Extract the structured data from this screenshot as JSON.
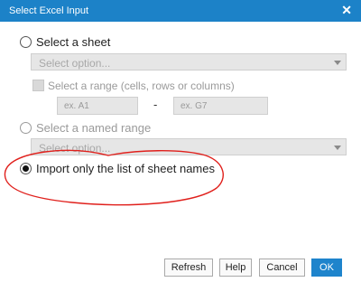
{
  "window": {
    "title": "Select Excel Input",
    "close_symbol": "✕"
  },
  "options": {
    "sheet": {
      "label": "Select a sheet",
      "select_placeholder": "Select option..."
    },
    "range": {
      "label": "Select a range (cells, rows or columns)",
      "from_placeholder": "ex. A1",
      "separator": "-",
      "to_placeholder": "ex. G7"
    },
    "named_range": {
      "label": "Select a named range",
      "select_placeholder": "Select option..."
    },
    "import_names": {
      "label": "Import only the list of sheet names",
      "selected": true
    }
  },
  "buttons": {
    "refresh": "Refresh",
    "help": "Help",
    "cancel": "Cancel",
    "ok": "OK"
  },
  "colors": {
    "titlebar": "#1c82c8",
    "primary_button": "#1e84cc",
    "annotation": "#e0201c"
  }
}
